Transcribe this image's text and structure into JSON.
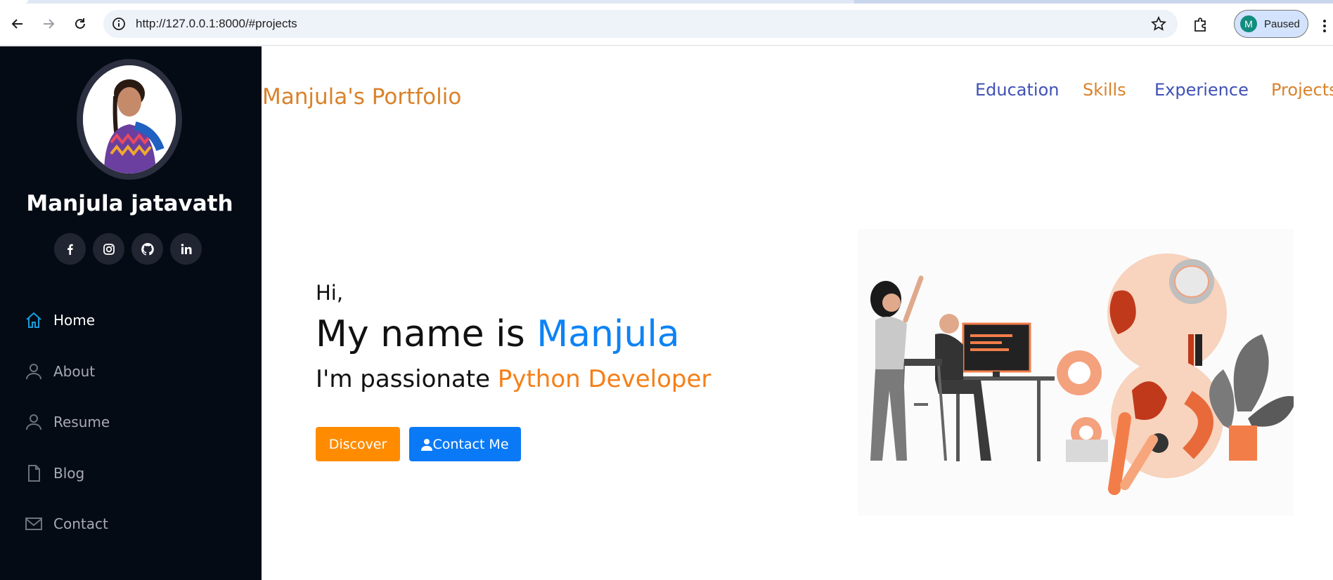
{
  "browser": {
    "url": "http://127.0.0.1:8000/#projects",
    "profile_initial": "M",
    "profile_status": "Paused"
  },
  "sidebar": {
    "name": "Manjula jatavath",
    "social": [
      "facebook-icon",
      "instagram-icon",
      "github-icon",
      "linkedin-icon"
    ],
    "nav": [
      {
        "label": "Home",
        "icon": "home-icon",
        "active": true
      },
      {
        "label": "About",
        "icon": "user-icon"
      },
      {
        "label": "Resume",
        "icon": "user-icon"
      },
      {
        "label": "Blog",
        "icon": "file-icon"
      },
      {
        "label": "Contact",
        "icon": "envelope-icon"
      }
    ]
  },
  "header": {
    "brand": "Manjula's Portfolio",
    "links": [
      {
        "label": "Education",
        "color": "#3f51b5"
      },
      {
        "label": "Skills",
        "color": "#d9822b"
      },
      {
        "label": "Experience",
        "color": "#3f51b5"
      },
      {
        "label": "Projects",
        "color": "#d9822b"
      }
    ]
  },
  "hero": {
    "greeting": "Hi,",
    "title_prefix": "My name is ",
    "title_name": "Manjula",
    "sub_prefix": "I'm passionate ",
    "sub_role": "Python Developer",
    "discover_label": "Discover",
    "contact_label": "Contact Me"
  },
  "colors": {
    "sidebar_bg": "#040b14",
    "accent_blue": "#0d83f5",
    "accent_orange": "#f57f17",
    "discover_btn": "#ff8c00",
    "contact_btn": "#0a79f5"
  }
}
